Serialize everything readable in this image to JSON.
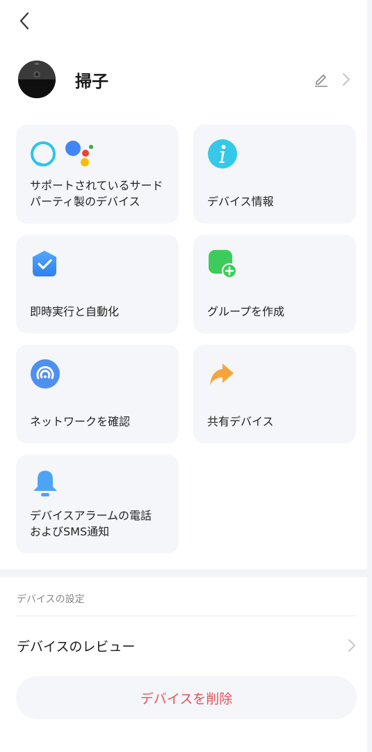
{
  "header": {
    "device_name": "掃子"
  },
  "cards": [
    {
      "label": "サポートされているサードパーティ製のデバイス",
      "icon": "third-party-assistants-icon"
    },
    {
      "label": "デバイス情報",
      "icon": "info-icon"
    },
    {
      "label": "即時実行と自動化",
      "icon": "automation-shield-icon"
    },
    {
      "label": "グループを作成",
      "icon": "create-group-icon"
    },
    {
      "label": "ネットワークを確認",
      "icon": "network-icon"
    },
    {
      "label": "共有デバイス",
      "icon": "share-icon"
    },
    {
      "label": "デバイスアラームの電話\nおよびSMS通知",
      "icon": "bell-icon"
    }
  ],
  "settings": {
    "section_title": "デバイスの設定",
    "review_label": "デバイスのレビュー",
    "delete_label": "デバイスを削除"
  },
  "colors": {
    "card_bg": "#f4f6fa",
    "delete_text": "#e5535b",
    "accent_blue": "#3f8cf0",
    "green": "#3dcc5c",
    "orange": "#f7a53b"
  }
}
